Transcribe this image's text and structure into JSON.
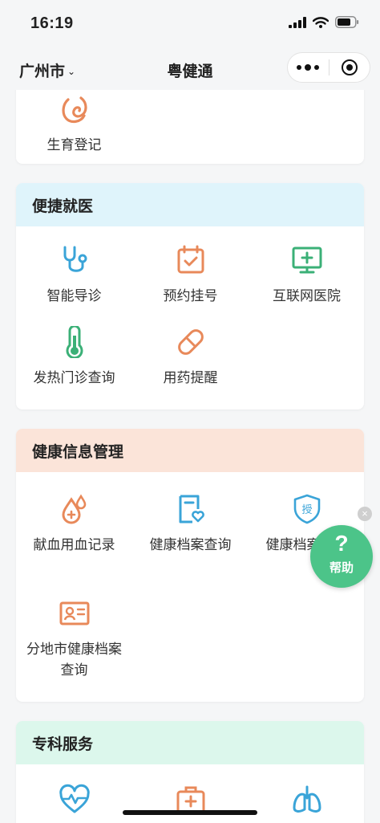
{
  "status_bar": {
    "time": "16:19"
  },
  "nav": {
    "city": "广州市",
    "title": "粤健通"
  },
  "sections": {
    "top": {
      "items": [
        {
          "label": "生育登记",
          "icon": "fertility-icon"
        }
      ]
    },
    "convenient": {
      "title": "便捷就医",
      "header_color": "#dff4fb",
      "items": [
        {
          "label": "智能导诊",
          "icon": "stethoscope-icon"
        },
        {
          "label": "预约挂号",
          "icon": "calendar-check-icon"
        },
        {
          "label": "互联网医院",
          "icon": "monitor-plus-icon"
        },
        {
          "label": "发热门诊查询",
          "icon": "thermometer-icon"
        },
        {
          "label": "用药提醒",
          "icon": "pill-icon"
        }
      ]
    },
    "health_info": {
      "title": "健康信息管理",
      "header_color": "#fbe4d9",
      "items": [
        {
          "label": "献血用血记录",
          "icon": "blood-drop-icon"
        },
        {
          "label": "健康档案查询",
          "icon": "health-file-icon"
        },
        {
          "label": "健康档案授权",
          "icon": "authorize-shield-icon",
          "badge": "授"
        },
        {
          "label": "分地市健康档案查询",
          "icon": "id-card-icon"
        }
      ]
    },
    "specialty": {
      "title": "专科服务",
      "header_color": "#dcf7ec",
      "items": [
        {
          "label": "",
          "icon": "heart-pulse-icon"
        },
        {
          "label": "",
          "icon": "medical-kit-icon"
        },
        {
          "label": "",
          "icon": "lungs-icon"
        }
      ]
    }
  },
  "help": {
    "label": "帮助",
    "symbol": "?",
    "close": "×"
  },
  "colors": {
    "orange": "#e8895a",
    "blue": "#3aa4d8",
    "green": "#3bb077"
  }
}
